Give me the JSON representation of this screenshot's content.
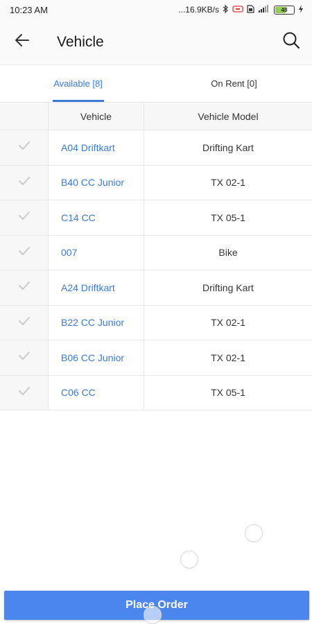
{
  "status_bar": {
    "time": "10:23 AM",
    "network_speed": "...16.9KB/s",
    "battery_level": "48",
    "icons": [
      "bluetooth-icon",
      "screen-record-icon",
      "sim-icon",
      "signal-icon",
      "battery-icon",
      "charging-icon"
    ]
  },
  "app_bar": {
    "title": "Vehicle",
    "back_icon": "arrow-left-icon",
    "search_icon": "search-icon"
  },
  "tabs": [
    {
      "label": "Available [8]",
      "active": true
    },
    {
      "label": "On Rent [0]",
      "active": false
    }
  ],
  "table": {
    "headers": [
      "",
      "Vehicle",
      "Vehicle Model"
    ],
    "rows": [
      {
        "vehicle": "A04 Driftkart",
        "model": "Drifting Kart"
      },
      {
        "vehicle": "B40 CC Junior",
        "model": "TX 02-1"
      },
      {
        "vehicle": "C14 CC",
        "model": "TX 05-1"
      },
      {
        "vehicle": "007",
        "model": "Bike"
      },
      {
        "vehicle": "A24 Driftkart",
        "model": "Drifting Kart"
      },
      {
        "vehicle": "B22 CC Junior",
        "model": "TX 02-1"
      },
      {
        "vehicle": "B06 CC Junior",
        "model": "TX 02-1"
      },
      {
        "vehicle": "C06 CC",
        "model": "TX 05-1"
      }
    ]
  },
  "footer": {
    "place_order_label": "Place Order"
  },
  "colors": {
    "accent": "#3a7bd5",
    "button": "#4a86ee"
  }
}
